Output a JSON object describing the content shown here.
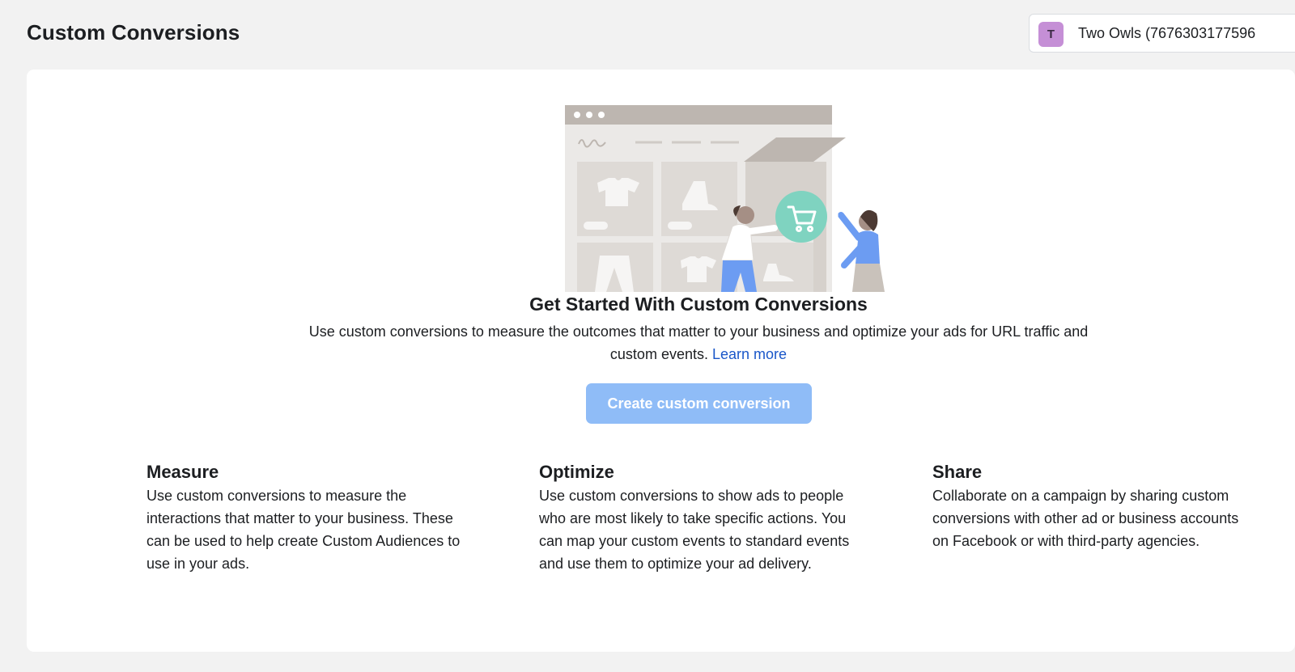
{
  "header": {
    "title": "Custom Conversions",
    "account": {
      "avatar_letter": "T",
      "name": "Two Owls (7676303177596",
      "avatar_color": "#c58fd6"
    }
  },
  "hero": {
    "title": "Get Started With Custom Conversions",
    "description": "Use custom conversions to measure the outcomes that matter to your business and optimize your ads for URL traffic and custom events.",
    "learn_more": "Learn more",
    "create_button": "Create custom conversion",
    "button_color": "#8fbcf7",
    "link_color": "#1a57c9"
  },
  "features": [
    {
      "title": "Measure",
      "text": "Use custom conversions to measure the interactions that matter to your business. These can be used to help create Custom Audiences to use in your ads."
    },
    {
      "title": "Optimize",
      "text": "Use custom conversions to show ads to people who are most likely to take specific actions. You can map your custom events to standard events and use them to optimize your ad delivery."
    },
    {
      "title": "Share",
      "text": "Collaborate on a campaign by sharing custom conversions with other ad or business accounts on Facebook or with third-party agencies."
    }
  ],
  "icons": {
    "illustration": "online-store-illustration",
    "cart": "shopping-cart-icon"
  }
}
